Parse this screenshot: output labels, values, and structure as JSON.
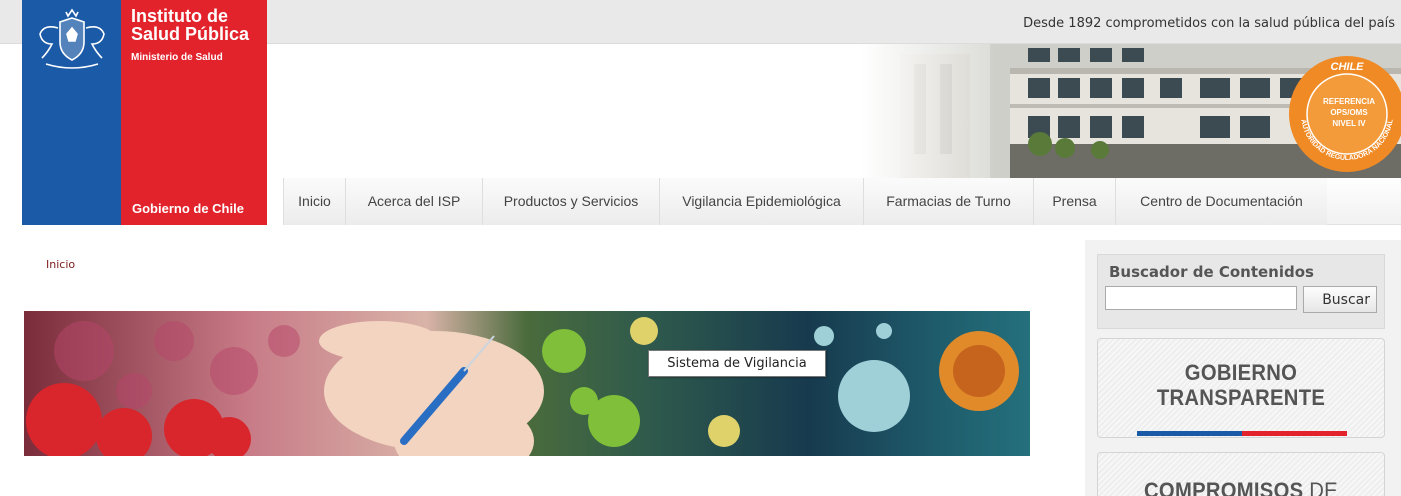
{
  "header": {
    "tagline": "Desde 1892 comprometidos con la salud pública del país",
    "logo": {
      "title_line1": "Instituto de",
      "title_line2": "Salud Pública",
      "subtitle": "Ministerio de Salud",
      "footer": "Gobierno de Chile"
    },
    "seal": {
      "top": "CHILE",
      "line1": "REFERENCIA",
      "line2": "OPS/OMS",
      "line3": "NIVEL IV",
      "ring": "AUTORIDAD REGULADORA NACIONAL"
    }
  },
  "nav": {
    "items": [
      {
        "label": "Inicio"
      },
      {
        "label": "Acerca del ISP"
      },
      {
        "label": "Productos y Servicios"
      },
      {
        "label": "Vigilancia Epidemiológica"
      },
      {
        "label": "Farmacias de Turno"
      },
      {
        "label": "Prensa"
      },
      {
        "label": "Centro de Documentación"
      }
    ]
  },
  "breadcrumb": {
    "label": "Inicio"
  },
  "banner": {
    "tooltip": "Sistema de Vigilancia"
  },
  "sidebar": {
    "search": {
      "title": "Buscador de Contenidos",
      "value": "",
      "button": "Buscar"
    },
    "gobierno": {
      "line1": "GOBIERNO",
      "line2": "TRANSPARENTE"
    },
    "compromisos": {
      "bold": "COMPROMISOS",
      "rest": " DE"
    }
  },
  "colors": {
    "chile_blue": "#1b5aa6",
    "chile_red": "#e2232b",
    "seal_orange": "#f08a24"
  }
}
